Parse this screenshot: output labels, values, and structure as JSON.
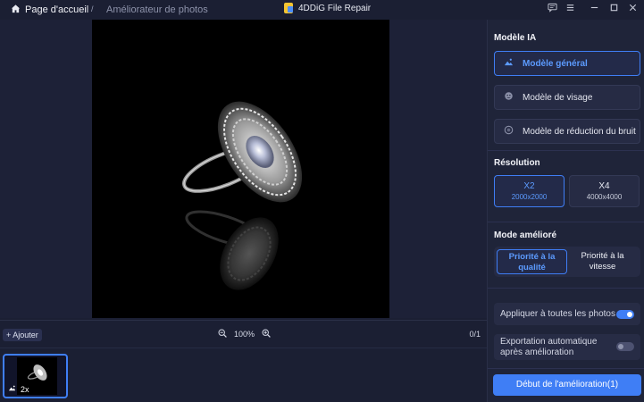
{
  "titlebar": {
    "home_label": "Page d'accueil",
    "separator": "/",
    "breadcrumb": "Améliorateur de photos",
    "app_title": "4DDiG File Repair"
  },
  "toolbar": {
    "add_label": "+ Ajouter",
    "zoom_level": "100%",
    "counter": "0/1"
  },
  "thumbnails": [
    {
      "scale_label": "2x"
    }
  ],
  "panel": {
    "model_title": "Modèle IA",
    "models": [
      {
        "label": "Modèle général",
        "icon": "landscape-icon",
        "active": true
      },
      {
        "label": "Modèle de visage",
        "icon": "face-icon",
        "active": false
      },
      {
        "label": "Modèle de réduction du bruit",
        "icon": "noise-icon",
        "active": false
      }
    ],
    "resolution_title": "Résolution",
    "resolutions": [
      {
        "label": "X2",
        "size": "2000x2000",
        "active": true
      },
      {
        "label": "X4",
        "size": "4000x4000",
        "active": false
      }
    ],
    "mode_title": "Mode amélioré",
    "modes": [
      {
        "line1": "Priorité à la",
        "line2": "qualité",
        "active": true
      },
      {
        "line1": "Priorité à la",
        "line2": "vitesse",
        "active": false
      }
    ],
    "apply_all_label": "Appliquer à toutes les photos",
    "apply_all_on": true,
    "auto_export_line1": "Exportation automatique",
    "auto_export_line2": "après amélioration",
    "auto_export_on": false,
    "start_label": "Début de l'amélioration(1)"
  },
  "colors": {
    "accent": "#3f7ef5",
    "accent_text": "#5c9bff",
    "background": "#1b1f33",
    "panel": "#1f2439"
  }
}
